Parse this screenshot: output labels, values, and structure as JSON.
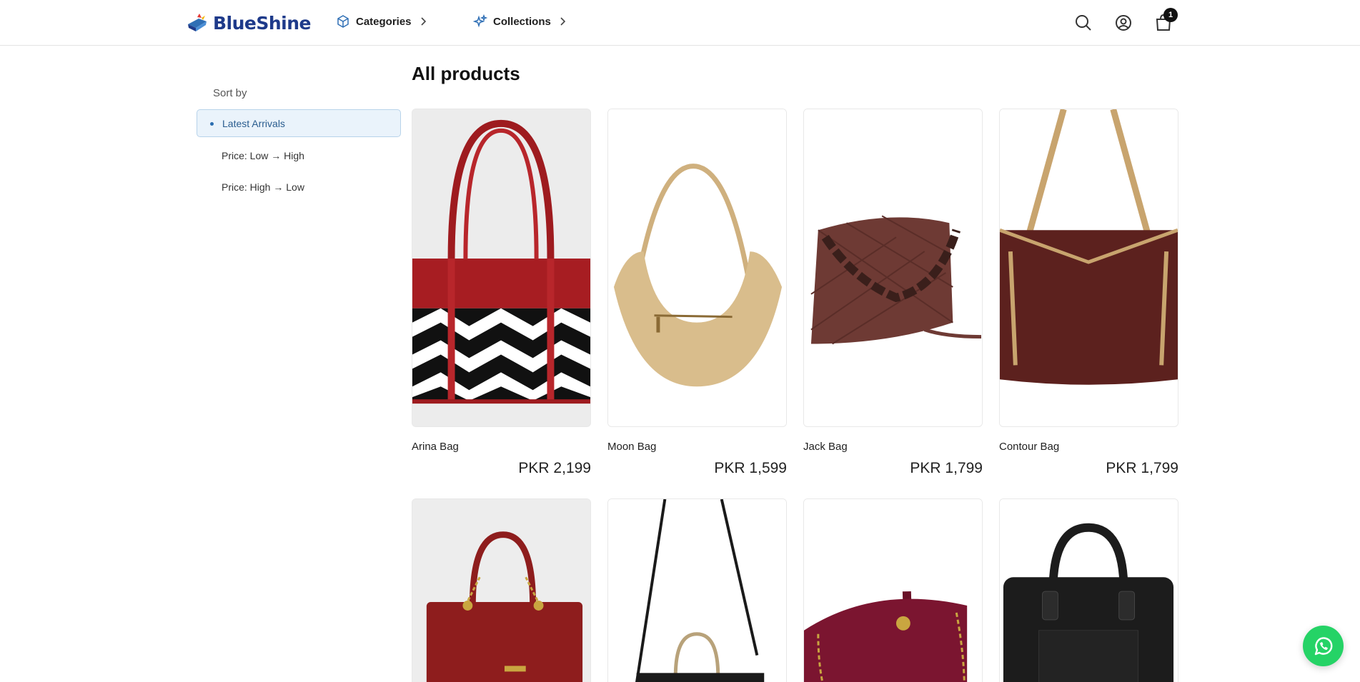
{
  "header": {
    "brand": "BlueShine",
    "nav": [
      {
        "label": "Categories",
        "icon": "cube-icon"
      },
      {
        "label": "Collections",
        "icon": "sparkles-icon"
      }
    ],
    "cart_count": "1"
  },
  "sidebar": {
    "sort_label": "Sort by",
    "options": [
      {
        "label": "Latest Arrivals",
        "active": true
      },
      {
        "label": "Price: Low → High",
        "active": false
      },
      {
        "label": "Price: High → Low",
        "active": false
      }
    ]
  },
  "main": {
    "title": "All products",
    "products": [
      {
        "name": "Arina Bag",
        "price": "PKR 2,199"
      },
      {
        "name": "Moon Bag",
        "price": "PKR 1,599"
      },
      {
        "name": "Jack Bag",
        "price": "PKR 1,799"
      },
      {
        "name": "Contour Bag",
        "price": "PKR 1,799"
      }
    ]
  },
  "colors": {
    "brand": "#1e3a8a",
    "active_sort_bg": "#eaf3fb",
    "whatsapp": "#25d366"
  }
}
